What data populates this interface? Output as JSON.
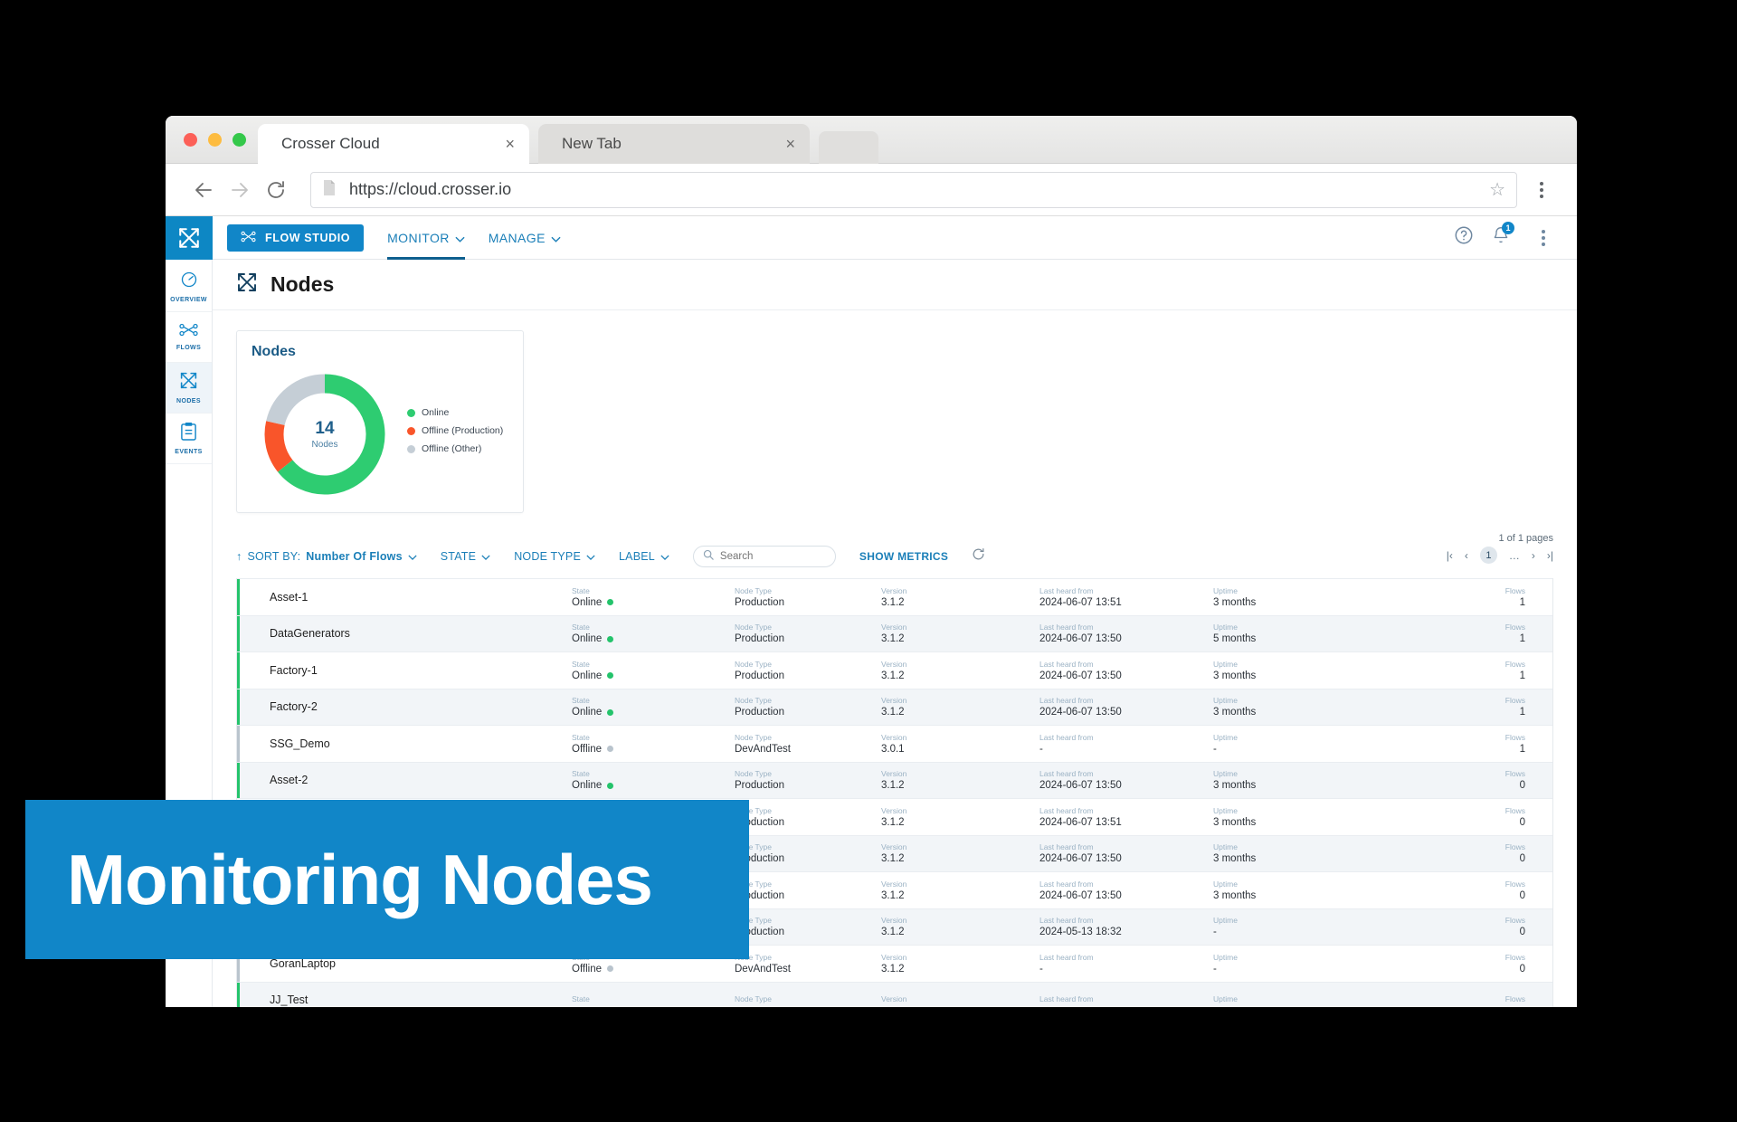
{
  "browser": {
    "tabs": [
      {
        "title": "Crosser Cloud",
        "active": true,
        "close": "×"
      },
      {
        "title": "New Tab",
        "active": false,
        "close": "×"
      }
    ],
    "url": "https://cloud.crosser.io",
    "back_icon": "back-arrow-icon",
    "forward_icon": "forward-arrow-icon",
    "reload_icon": "reload-icon",
    "star_icon": "bookmark-star-icon",
    "menu_icon": "browser-menu-icon"
  },
  "appbar": {
    "logo": "crosser-logo-icon",
    "flow_studio": "FLOW STUDIO",
    "nav": [
      {
        "label": "MONITOR",
        "active": true
      },
      {
        "label": "MANAGE",
        "active": false
      }
    ],
    "help_icon": "help-icon",
    "notifications_icon": "bell-icon",
    "notification_count": "1",
    "more_icon": "vertical-dots-icon"
  },
  "sidebar": {
    "items": [
      {
        "label": "OVERVIEW",
        "icon": "gauge-icon",
        "active": false
      },
      {
        "label": "FLOWS",
        "icon": "flow-graph-icon",
        "active": false
      },
      {
        "label": "NODES",
        "icon": "nodes-arrows-icon",
        "active": true
      },
      {
        "label": "EVENTS",
        "icon": "clipboard-icon",
        "active": false
      }
    ]
  },
  "page": {
    "title": "Nodes",
    "title_icon": "nodes-arrows-icon"
  },
  "chart_data": {
    "type": "pie",
    "title": "Nodes",
    "center_value": "14",
    "center_label": "Nodes",
    "categories": [
      "Online",
      "Offline (Production)",
      "Offline (Other)"
    ],
    "values": [
      9,
      2,
      3
    ],
    "colors": [
      "#2ecc71",
      "#f9552a",
      "#c5ced6"
    ],
    "legend_position": "right",
    "donut": true
  },
  "filters": {
    "sort_prefix": "SORT BY:",
    "sort_value": "Number Of Flows",
    "sort_arrow": "↑",
    "state": "STATE",
    "node_type": "NODE TYPE",
    "label": "LABEL",
    "chevron": "⌄",
    "search_placeholder": "Search",
    "search_value": "",
    "search_icon": "search-icon",
    "show_metrics": "SHOW METRICS",
    "refresh_icon": "refresh-icon"
  },
  "pagination": {
    "summary": "1 of 1 pages",
    "first": "|‹",
    "prev": "‹",
    "current": "1",
    "ellipsis": "…",
    "next": "›",
    "last": "›|"
  },
  "table": {
    "headers": {
      "state": "State",
      "node_type": "Node Type",
      "version": "Version",
      "last_heard": "Last heard from",
      "uptime": "Uptime",
      "flows": "Flows"
    },
    "rows": [
      {
        "name": "Asset-1",
        "state": "Online",
        "node_type": "Production",
        "version": "3.1.2",
        "last_heard": "2024-06-07 13:51",
        "uptime": "3 months",
        "flows": "1"
      },
      {
        "name": "DataGenerators",
        "state": "Online",
        "node_type": "Production",
        "version": "3.1.2",
        "last_heard": "2024-06-07 13:50",
        "uptime": "5 months",
        "flows": "1"
      },
      {
        "name": "Factory-1",
        "state": "Online",
        "node_type": "Production",
        "version": "3.1.2",
        "last_heard": "2024-06-07 13:50",
        "uptime": "3 months",
        "flows": "1"
      },
      {
        "name": "Factory-2",
        "state": "Online",
        "node_type": "Production",
        "version": "3.1.2",
        "last_heard": "2024-06-07 13:50",
        "uptime": "3 months",
        "flows": "1"
      },
      {
        "name": "SSG_Demo",
        "state": "Offline",
        "node_type": "DevAndTest",
        "version": "3.0.1",
        "last_heard": "-",
        "uptime": "-",
        "flows": "1"
      },
      {
        "name": "Asset-2",
        "state": "Online",
        "node_type": "Production",
        "version": "3.1.2",
        "last_heard": "2024-06-07 13:50",
        "uptime": "3 months",
        "flows": "0"
      },
      {
        "name": "",
        "state": "",
        "node_type": "Production",
        "version": "3.1.2",
        "last_heard": "2024-06-07 13:51",
        "uptime": "3 months",
        "flows": "0"
      },
      {
        "name": "",
        "state": "",
        "node_type": "Production",
        "version": "3.1.2",
        "last_heard": "2024-06-07 13:50",
        "uptime": "3 months",
        "flows": "0"
      },
      {
        "name": "",
        "state": "",
        "node_type": "Production",
        "version": "3.1.2",
        "last_heard": "2024-06-07 13:50",
        "uptime": "3 months",
        "flows": "0"
      },
      {
        "name": "",
        "state": "",
        "node_type": "Production",
        "version": "3.1.2",
        "last_heard": "2024-05-13 18:32",
        "uptime": "-",
        "flows": "0"
      },
      {
        "name": "GoranLaptop",
        "state": "Offline",
        "node_type": "DevAndTest",
        "version": "3.1.2",
        "last_heard": "-",
        "uptime": "-",
        "flows": "0"
      },
      {
        "name": "JJ_Test",
        "state": "",
        "node_type": "",
        "version": "",
        "last_heard": "",
        "uptime": "",
        "flows": ""
      }
    ]
  },
  "overlay": {
    "text": "Monitoring Nodes",
    "color": "#1186c8"
  }
}
